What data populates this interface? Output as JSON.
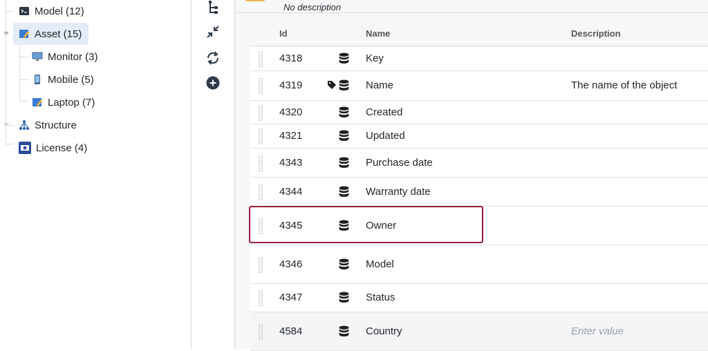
{
  "tree": {
    "items": [
      {
        "label": "Model (12)",
        "icon": "terminal-icon"
      },
      {
        "label": "Asset (15)",
        "icon": "asset-icon",
        "selected": true
      },
      {
        "label": "Monitor (3)",
        "icon": "monitor-icon"
      },
      {
        "label": "Mobile (5)",
        "icon": "mobile-icon"
      },
      {
        "label": "Laptop (7)",
        "icon": "laptop-icon"
      },
      {
        "label": "Structure",
        "icon": "structure-icon"
      },
      {
        "label": "License (4)",
        "icon": "license-icon"
      }
    ]
  },
  "toolbar": {
    "tools": [
      "hierarchy-icon",
      "collapse-icon",
      "refresh-icon",
      "add-icon"
    ]
  },
  "main": {
    "description": "No description",
    "table": {
      "columns": {
        "id": "Id",
        "name": "Name",
        "description": "Description"
      },
      "rows": [
        {
          "id": "4318",
          "name": "Key",
          "description": "",
          "tag": false
        },
        {
          "id": "4319",
          "name": "Name",
          "description": "The name of the object",
          "tag": true
        },
        {
          "id": "4320",
          "name": "Created",
          "description": "",
          "tag": false
        },
        {
          "id": "4321",
          "name": "Updated",
          "description": "",
          "tag": false
        },
        {
          "id": "4343",
          "name": "Purchase date",
          "description": "",
          "tag": false
        },
        {
          "id": "4344",
          "name": "Warranty date",
          "description": "",
          "tag": false
        },
        {
          "id": "4345",
          "name": "Owner",
          "description": "",
          "tag": false,
          "highlighted": true
        },
        {
          "id": "4346",
          "name": "Model",
          "description": "",
          "tag": false
        },
        {
          "id": "4347",
          "name": "Status",
          "description": "",
          "tag": false
        },
        {
          "id": "4584",
          "name": "Country",
          "description": "",
          "placeholder": "Enter value",
          "tag": false
        }
      ]
    }
  },
  "colors": {
    "highlight": "#9a1c3a",
    "selected": "#e3ecf7",
    "accent": "#2a5db0"
  }
}
